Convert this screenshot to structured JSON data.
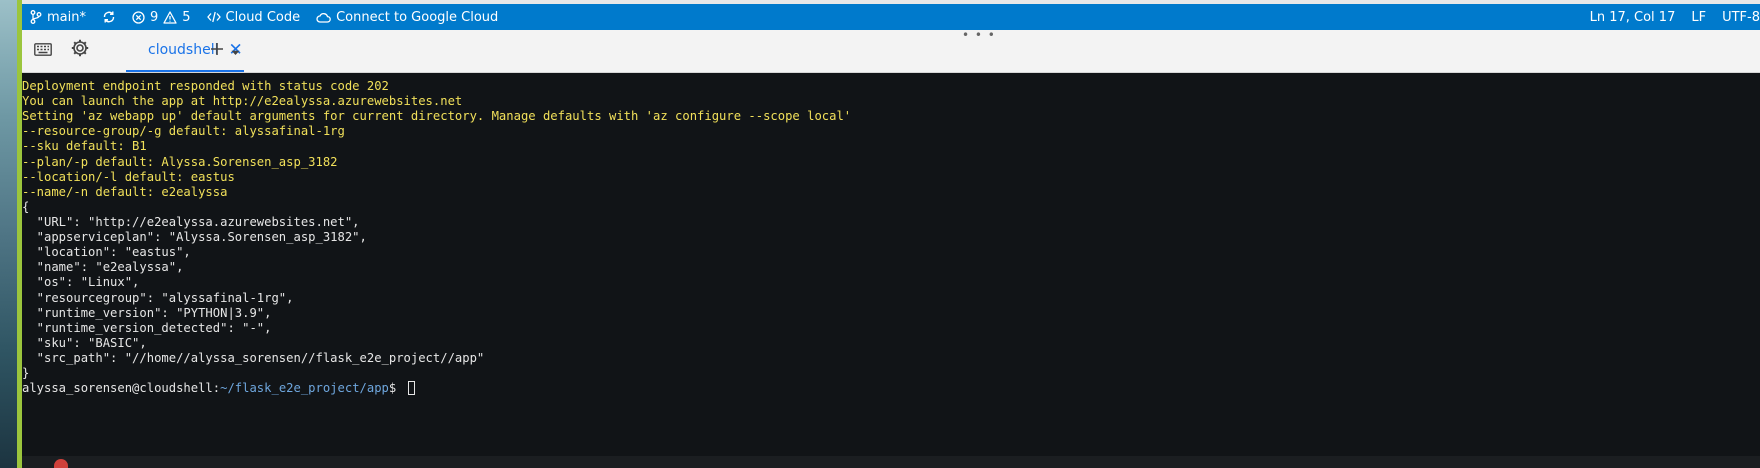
{
  "statusbar": {
    "branch": "main*",
    "errors": "9",
    "warnings": "5",
    "cloud_code": "Cloud Code",
    "connect": "Connect to Google Cloud",
    "cursor_position": "Ln 17, Col 17",
    "eol": "LF",
    "encoding": "UTF-8"
  },
  "toolbar": {
    "tab_label": "cloudshell"
  },
  "terminal": {
    "lines": [
      "Deployment endpoint responded with status code 202",
      "You can launch the app at http://e2ealyssa.azurewebsites.net",
      "Setting 'az webapp up' default arguments for current directory. Manage defaults with 'az configure --scope local'",
      "--resource-group/-g default: alyssafinal-1rg",
      "--sku default: B1",
      "--plan/-p default: Alyssa.Sorensen_asp_3182",
      "--location/-l default: eastus",
      "--name/-n default: e2ealyssa",
      "{",
      "  \"URL\": \"http://e2ealyssa.azurewebsites.net\",",
      "  \"appserviceplan\": \"Alyssa.Sorensen_asp_3182\",",
      "  \"location\": \"eastus\",",
      "  \"name\": \"e2ealyssa\",",
      "  \"os\": \"Linux\",",
      "  \"resourcegroup\": \"alyssafinal-1rg\",",
      "  \"runtime_version\": \"PYTHON|3.9\",",
      "  \"runtime_version_detected\": \"-\",",
      "  \"sku\": \"BASIC\",",
      "  \"src_path\": \"//home//alyssa_sorensen//flask_e2e_project//app\"",
      "}"
    ],
    "prompt_user": "alyssa_sorensen@cloudshell:",
    "prompt_path": "~/flask_e2e_project/app",
    "prompt_symbol": "$ "
  },
  "colors": {
    "statusbar": "#007acc",
    "terminal_bg": "#111417",
    "output_yellow": "#f1e05a",
    "prompt_path": "#6ea6dd",
    "tab_accent": "#1a73e8"
  }
}
